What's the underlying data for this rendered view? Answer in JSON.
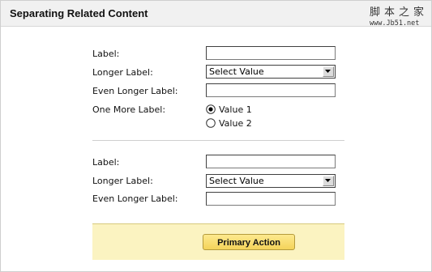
{
  "header": {
    "title": "Separating Related Content",
    "watermark_cn": "脚本之家",
    "watermark_url": "www.Jb51.net"
  },
  "section1": {
    "label_1": "Label:",
    "label_2": "Longer Label:",
    "select_value": "Select Value",
    "label_3": "Even Longer Label:",
    "label_4": "One More Label:",
    "radio_1": "Value 1",
    "radio_2": "Value 2",
    "radio_selected": "Value 1"
  },
  "section2": {
    "label_1": "Label:",
    "label_2": "Longer Label:",
    "select_value": "Select Value",
    "label_3": "Even Longer Label:"
  },
  "actions": {
    "primary_label": "Primary Action"
  },
  "colors": {
    "action_bar_bg": "#fbf3c1",
    "primary_button": "#f4d35a",
    "header_bg": "#f1f1f1"
  }
}
